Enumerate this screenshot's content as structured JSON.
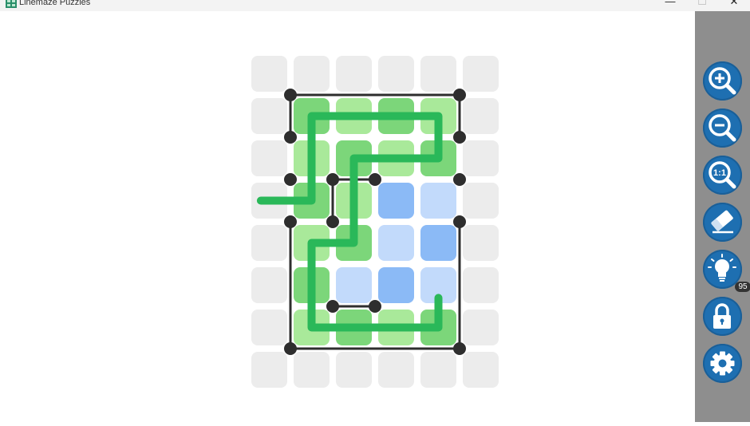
{
  "window": {
    "title": "Linemaze Puzzles",
    "controls": {
      "minimize": "—",
      "maximize": "☐",
      "close": "✕"
    }
  },
  "colors": {
    "empty_cell": "#ececec",
    "green_dark": "#7cd67a",
    "green_light": "#a9e99a",
    "blue_dark": "#8bbaf6",
    "blue_light": "#c2dafb",
    "path": "#2ab859",
    "wall": "#2e2e2e",
    "tool_button": "#1e6fb1",
    "sidebar": "#8e8e8e"
  },
  "puzzle": {
    "columns": 6,
    "rows": 8,
    "cells": [
      "EEEEEE",
      "EGgGgE",
      "EgGgGE",
      "EGgBbE",
      "EgGbBE",
      "EGbBbE",
      "EgGgGE",
      "EEEEEE"
    ],
    "walls": [
      [
        [
          1,
          1
        ],
        [
          5,
          1
        ]
      ],
      [
        [
          1,
          1
        ],
        [
          1,
          2
        ]
      ],
      [
        [
          5,
          1
        ],
        [
          5,
          2
        ]
      ],
      [
        [
          2,
          3
        ],
        [
          3,
          3
        ]
      ],
      [
        [
          2,
          3
        ],
        [
          2,
          4
        ]
      ],
      [
        [
          1,
          4
        ],
        [
          1,
          7
        ]
      ],
      [
        [
          5,
          4
        ],
        [
          5,
          7
        ]
      ],
      [
        [
          1,
          7
        ],
        [
          5,
          7
        ]
      ],
      [
        [
          2,
          6
        ],
        [
          3,
          6
        ]
      ]
    ],
    "dots": [
      [
        1,
        1
      ],
      [
        5,
        1
      ],
      [
        1,
        2
      ],
      [
        5,
        2
      ],
      [
        1,
        3
      ],
      [
        2,
        3
      ],
      [
        3,
        3
      ],
      [
        5,
        3
      ],
      [
        1,
        4
      ],
      [
        2,
        4
      ],
      [
        5,
        4
      ],
      [
        2,
        6
      ],
      [
        3,
        6
      ],
      [
        1,
        7
      ],
      [
        5,
        7
      ]
    ],
    "path": [
      [
        0.3,
        3.5
      ],
      [
        1.5,
        3.5
      ],
      [
        1.5,
        1.5
      ],
      [
        4.5,
        1.5
      ],
      [
        4.5,
        2.5
      ],
      [
        2.5,
        2.5
      ],
      [
        2.5,
        4.5
      ],
      [
        1.5,
        4.5
      ],
      [
        1.5,
        6.5
      ],
      [
        4.5,
        6.5
      ],
      [
        4.5,
        5.8
      ]
    ]
  },
  "toolbar": {
    "buttons": [
      {
        "name": "zoom-in-button",
        "icon": "zoom-in-icon"
      },
      {
        "name": "zoom-out-button",
        "icon": "zoom-out-icon"
      },
      {
        "name": "zoom-reset-button",
        "icon": "zoom-actual-size-icon",
        "icon_text": "1:1"
      },
      {
        "name": "eraser-button",
        "icon": "eraser-icon"
      },
      {
        "name": "hint-button",
        "icon": "lightbulb-icon",
        "badge": "95"
      },
      {
        "name": "lock-button",
        "icon": "lock-icon"
      },
      {
        "name": "settings-button",
        "icon": "gear-icon"
      }
    ]
  }
}
